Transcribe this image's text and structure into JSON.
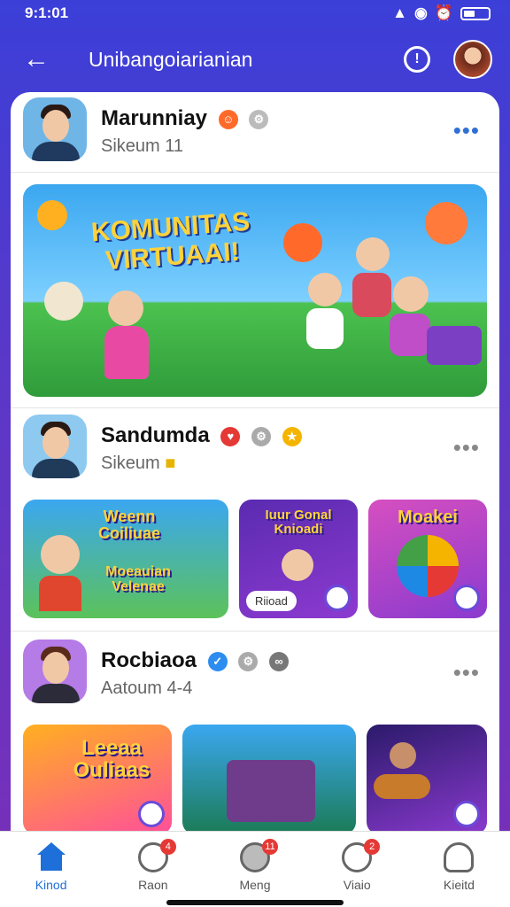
{
  "status": {
    "time": "9:1:01"
  },
  "header": {
    "title": "Unibangoiarianian"
  },
  "posts": [
    {
      "name": "Marunniay",
      "sub": "Sikeum 11"
    },
    {
      "name": "Sandumda",
      "sub": "Sikeum"
    },
    {
      "name": "Rocbiaoa",
      "sub": "Aatoum 4-4"
    }
  ],
  "banner": {
    "title_line1": "KOMUNITAS",
    "title_line2": "VIRTUAAI!"
  },
  "thumbs_row1": [
    {
      "title": "Weenn Coiliuae",
      "subtitle": "Moeauian Velenae"
    },
    {
      "title": "Iuur Gonal Knioadi",
      "chip": "Riioad"
    },
    {
      "title": "Moakei"
    }
  ],
  "thumbs_row2": [
    {
      "title": "Leeaa Ouliaas"
    },
    {
      "title": ""
    },
    {
      "title": ""
    }
  ],
  "nav": [
    {
      "label": "Kinod",
      "count": ""
    },
    {
      "label": "Raon",
      "count": "4"
    },
    {
      "label": "Meng",
      "count": "11"
    },
    {
      "label": "Viaio",
      "count": "2"
    },
    {
      "label": "Kieitd",
      "count": ""
    }
  ],
  "colors": {
    "accent": "#1e6fd9",
    "header_start": "#3b3fd8",
    "header_end": "#7a2fb8"
  }
}
